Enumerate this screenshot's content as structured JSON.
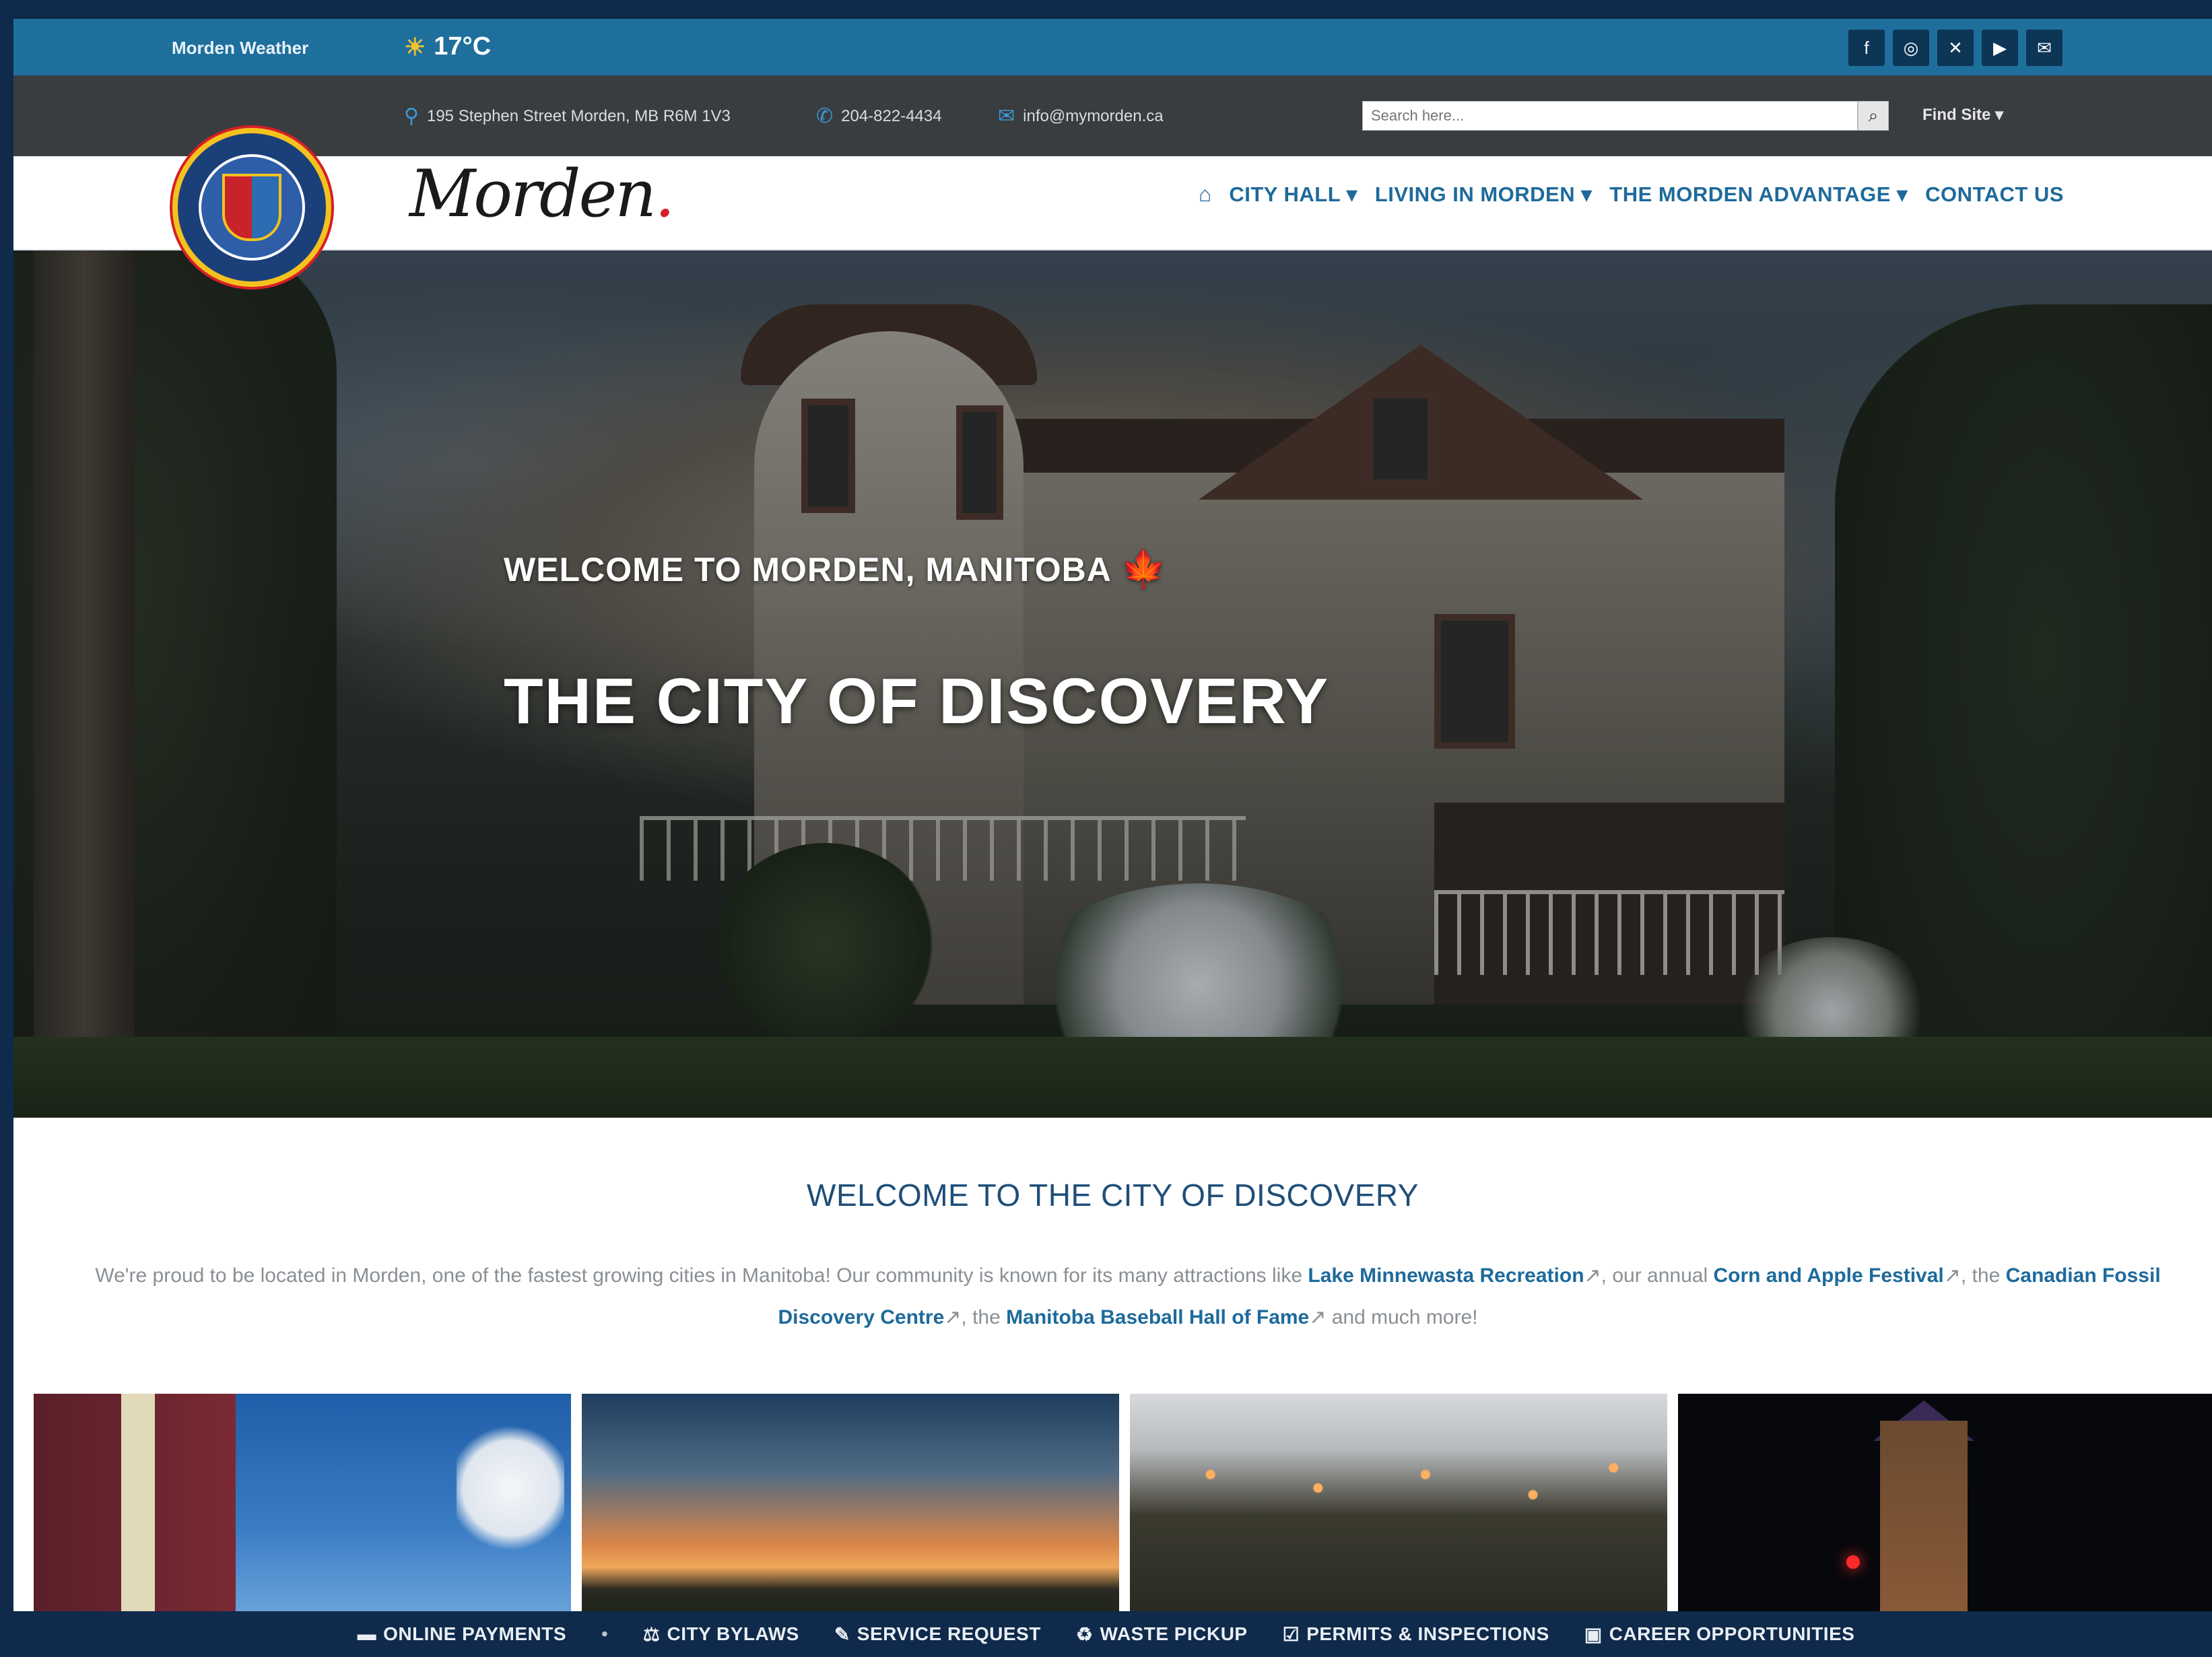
{
  "weather": {
    "label": "Morden Weather",
    "temp": "17°C",
    "icon": "sun-icon"
  },
  "social": [
    {
      "icon": "facebook-icon",
      "glyph": "f"
    },
    {
      "icon": "instagram-icon",
      "glyph": "◎"
    },
    {
      "icon": "x-icon",
      "glyph": "✕"
    },
    {
      "icon": "youtube-icon",
      "glyph": "▶"
    },
    {
      "icon": "email-icon",
      "glyph": "✉"
    }
  ],
  "info": {
    "address": "195 Stephen Street Morden, MB R6M 1V3",
    "phone": "204-822-4434",
    "email": "info@mymorden.ca"
  },
  "search": {
    "placeholder": "Search here...",
    "find_label": "Find Site"
  },
  "logo": {
    "text": "Morden"
  },
  "nav": {
    "items": [
      "CITY HALL",
      "LIVING IN MORDEN",
      "THE MORDEN ADVANTAGE",
      "CONTACT US"
    ]
  },
  "hero": {
    "subtitle": "WELCOME TO MORDEN, MANITOBA",
    "title": "THE CITY OF DISCOVERY"
  },
  "welcome": {
    "title": "WELCOME TO THE CITY OF DISCOVERY",
    "text_1": "We're proud to be located in Morden, one of the fastest growing cities in Manitoba! Our community is known for its many attractions like",
    "link_1": "Lake Minnewasta Recreation",
    "text_2": ", our annual",
    "link_2": "Corn and Apple Festival",
    "text_3": ", the",
    "link_3": "Canadian Fossil Discovery Centre",
    "text_4": ", the",
    "link_4": "Manitoba Baseball Hall of Fame",
    "text_5": "and much more!"
  },
  "quicklinks": [
    {
      "icon": "card-icon",
      "glyph": "▬",
      "label": "ONLINE PAYMENTS"
    },
    {
      "icon": "gavel-icon",
      "glyph": "⚖",
      "label": "CITY BYLAWS"
    },
    {
      "icon": "wrench-icon",
      "glyph": "✎",
      "label": "SERVICE REQUEST"
    },
    {
      "icon": "recycle-icon",
      "glyph": "♻",
      "label": "WASTE PICKUP"
    },
    {
      "icon": "checklist-icon",
      "glyph": "☑",
      "label": "PERMITS & INSPECTIONS"
    },
    {
      "icon": "briefcase-icon",
      "glyph": "▣",
      "label": "CAREER OPPORTUNITIES"
    }
  ],
  "colors": {
    "brand_blue": "#1f6f9c",
    "dark_navy": "#0f2a4a",
    "info_bar": "#3a3d40",
    "link_blue": "#1e6a9b",
    "accent_red": "#d61f26"
  }
}
